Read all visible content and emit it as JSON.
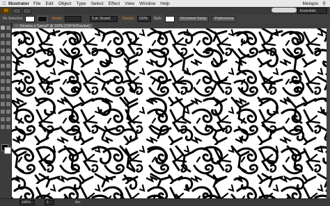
{
  "menubar": {
    "apple": "",
    "app_name": "Illustrator",
    "items": [
      "File",
      "Edit",
      "Object",
      "Type",
      "Select",
      "Effect",
      "View",
      "Window",
      "Help"
    ],
    "user": "Metapix"
  },
  "app_bar": {
    "logo": "Ai",
    "workspace": "Essentials"
  },
  "control_bar": {
    "selection_label": "No Selection",
    "stroke_label": "Stroke:",
    "stroke_value": "",
    "brush_value": "5 pt. Round",
    "opacity_label": "Opacity:",
    "opacity_value": "100%",
    "style_label": "Style:",
    "doc_setup_label": "Document Setup",
    "preferences_label": "Preferences"
  },
  "document": {
    "tab_title": "Dessine a Typical* @ 100% (CMYK/Preview)"
  },
  "status": {
    "zoom": "100%",
    "page": "1",
    "tool": "Arc"
  },
  "colors": {
    "fill": "#000000",
    "stroke": "#ffffff",
    "accent": "#e88a2a"
  }
}
